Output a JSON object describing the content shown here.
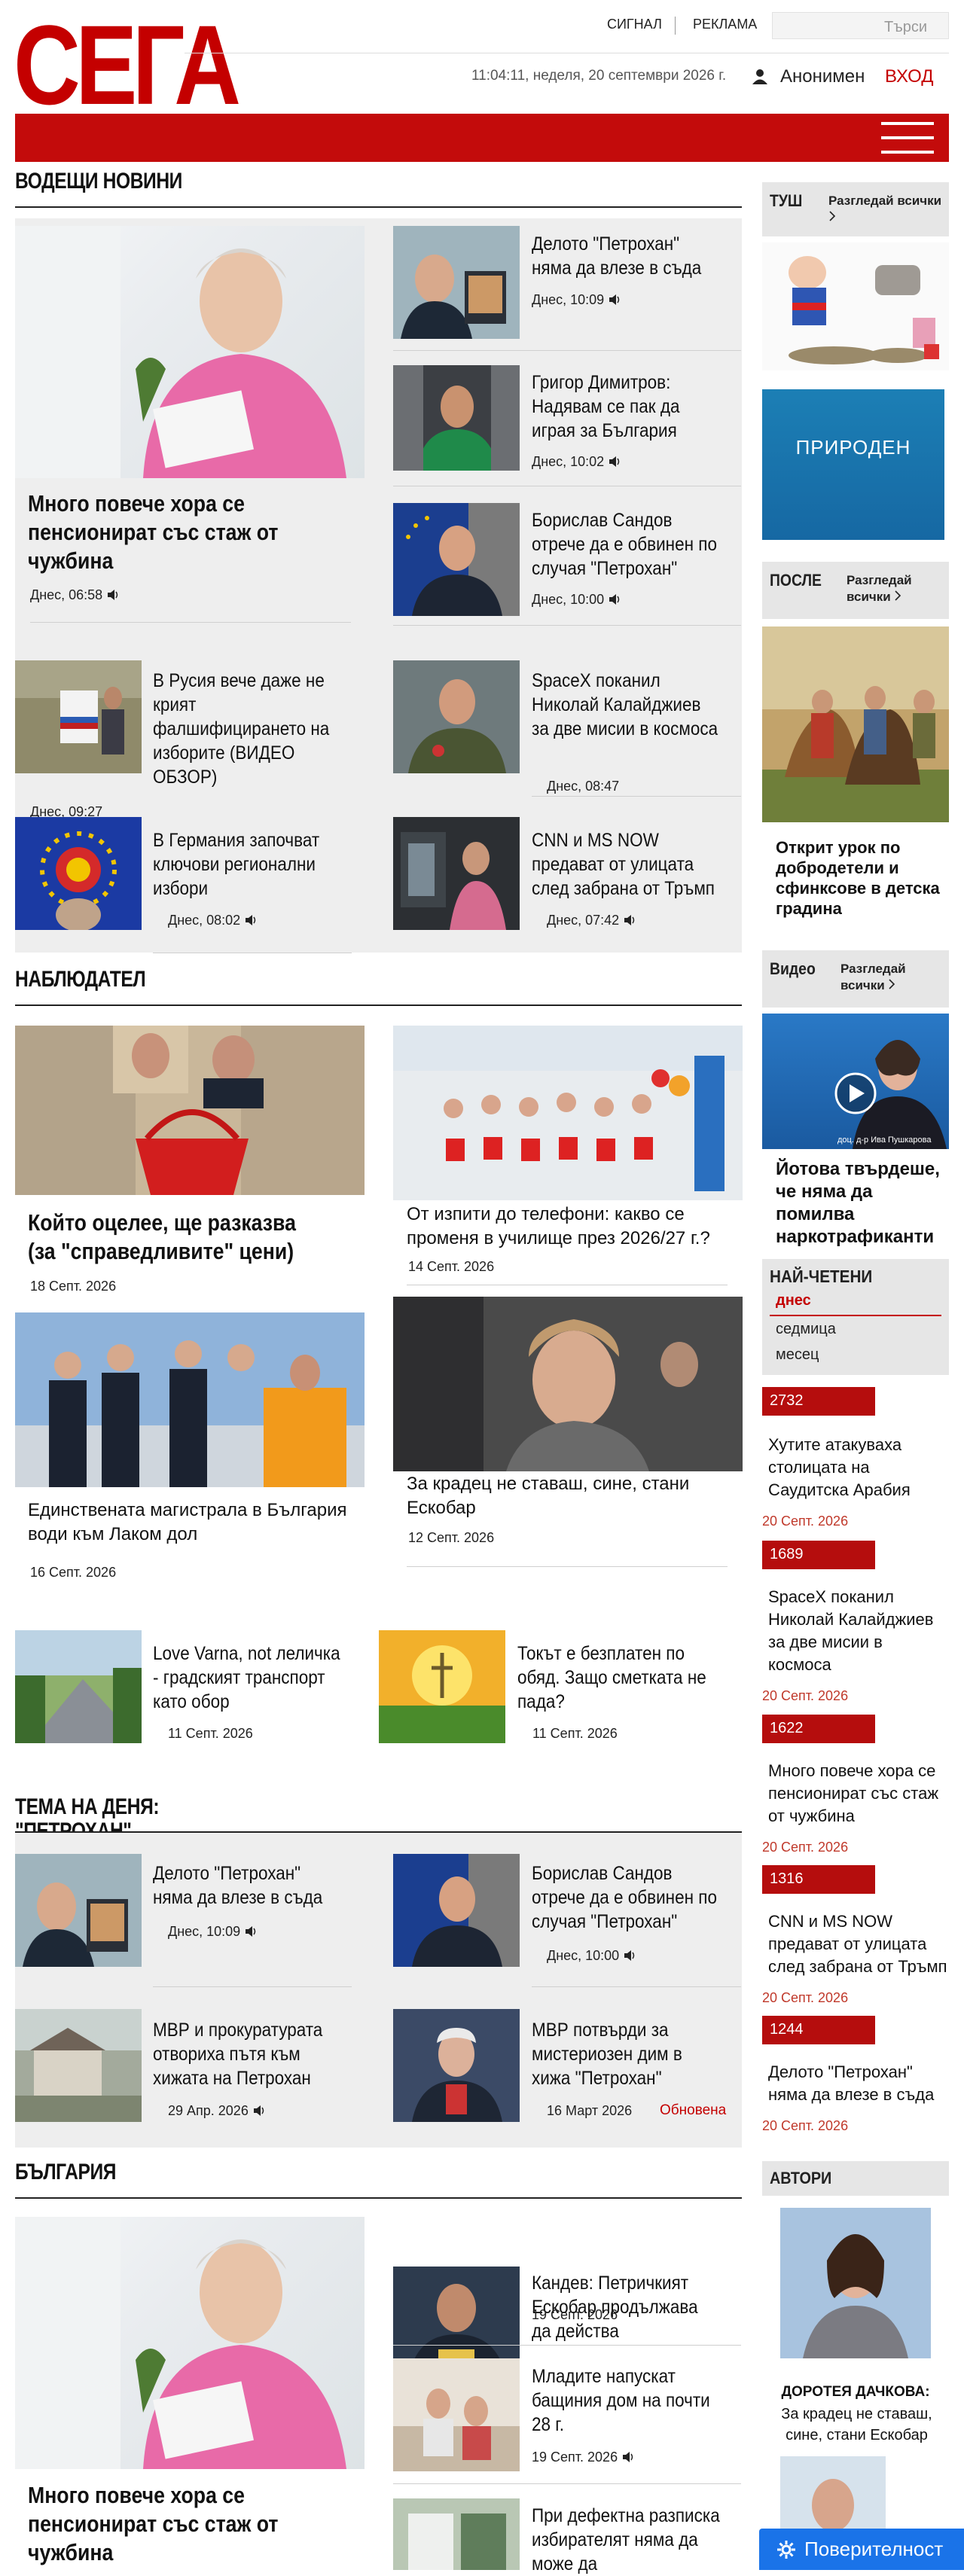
{
  "header": {
    "logo": "СЕГА",
    "nav_signal": "СИГНАЛ",
    "nav_ads": "РЕКЛАМА",
    "search_placeholder": "Търси",
    "datetime": "11:04:11, неделя, 20 септември 2026 г.",
    "user": "Анонимен",
    "login": "ВХОД"
  },
  "leading": {
    "title": "ВОДЕЩИ НОВИНИ",
    "main": {
      "title": "Много повече хора се пенсионират със стаж от чужбина",
      "time": "Днес, 06:58"
    },
    "right": [
      {
        "title": "Делото \"Петрохан\" няма да влезе в съда",
        "time": "Днес, 10:09"
      },
      {
        "title": "Григор Димитров: Надявам се пак да играя за България",
        "time": "Днес, 10:02"
      },
      {
        "title": "Борислав Сандов отрече да е обвинен по случая \"Петрохан\"",
        "time": "Днес, 10:00"
      }
    ],
    "grid": [
      {
        "title": "В Русия вече даже не крият фалшифицирането на изборите (ВИДЕО ОБЗОР)",
        "time": "Днес, 09:27"
      },
      {
        "title": "SpaceX поканил Николай Калайджиев за две мисии в космоса",
        "time": "Днес, 08:47"
      },
      {
        "title": "В Германия започват ключови регионални избори",
        "time": "Днес, 08:02"
      },
      {
        "title": "CNN и MS NOW предават от улицата след забрана от Тръмп",
        "time": "Днес, 07:42"
      }
    ]
  },
  "observer": {
    "title": "НАБЛЮДАТЕЛ",
    "items": [
      {
        "title": "Който оцелее, ще разказва (за \"справедливите\" цени)",
        "time": "18 Септ. 2026"
      },
      {
        "title": "От изпити до телефони: какво се променя в училище през 2026/27 г.?",
        "time": "14 Септ. 2026"
      },
      {
        "title": "Единствената магистрала в България води към Лаком дол",
        "time": "16 Септ. 2026"
      },
      {
        "title": "За крадец не ставаш, сине, стани Ескобар",
        "time": "12 Септ. 2026"
      },
      {
        "title": "Love Varna, not леличка - градският транспорт като обор",
        "time": "11 Септ. 2026"
      },
      {
        "title": "Токът е безплатен по обяд. Защо сметката не пада?",
        "time": "11 Септ. 2026"
      }
    ]
  },
  "topic": {
    "title": "ТЕМА НА ДЕНЯ: \"ПЕТРОХАН\"",
    "items": [
      {
        "title": "Делото \"Петрохан\" няма да влезе в съда",
        "time": "Днес, 10:09"
      },
      {
        "title": "Борислав Сандов отрече да е обвинен по случая \"Петрохан\"",
        "time": "Днес, 10:00"
      },
      {
        "title": "МВР и прокуратурата отвориха пътя към хижата на Петрохан",
        "time": "29 Апр. 2026"
      },
      {
        "title": "МВР потвърди за мистериозен дим в хижа \"Петрохан\"",
        "time": "16 Март 2026",
        "updated": "Обновена"
      }
    ]
  },
  "bulgaria": {
    "title": "БЪЛГАРИЯ",
    "main": {
      "title": "Много повече хора се пенсионират със стаж от чужбина"
    },
    "right": [
      {
        "title": "Кандев: Петричкият Ескобар продължава да действа",
        "time": "19 Септ. 2026"
      },
      {
        "title": "Младите напускат бащиния дом на почти 28 г.",
        "time": "19 Септ. 2026"
      },
      {
        "title": "При дефектна разписка избирателят няма да може да",
        "time": ""
      }
    ]
  },
  "sidebar": {
    "tush": {
      "label": "ТУШ",
      "more": "Разгледай всички"
    },
    "ad": {
      "text": "ПРИРОДЕН"
    },
    "posle": {
      "label": "ПОСЛЕ",
      "more": "Разгледай всички",
      "article": "Открит урок по добродетели и сфинксове в детска градина"
    },
    "video": {
      "label": "Видео",
      "more": "Разгледай всички",
      "article": "Йотова твърдеше, че няма да помилва наркотрафиканти",
      "caption": "доц. д-р Ива Пушкарова"
    },
    "mostread": {
      "label": "НАЙ-ЧЕТЕНИ",
      "tabs": [
        "днес",
        "седмица",
        "месец"
      ],
      "items": [
        {
          "count": "2732",
          "title": "Хутите атакуваха столицата на Саудитска Арабия",
          "date": "20 Септ. 2026"
        },
        {
          "count": "1689",
          "title": "SpaceX поканил Николай Калайджиев за две мисии в космоса",
          "date": "20 Септ. 2026"
        },
        {
          "count": "1622",
          "title": "Много повече хора се пенсионират със стаж от чужбина",
          "date": "20 Септ. 2026"
        },
        {
          "count": "1316",
          "title": "CNN и MS NOW предават от улицата след забрана от Тръмп",
          "date": "20 Септ. 2026"
        },
        {
          "count": "1244",
          "title": "Делото \"Петрохан\" няма да влезе в съда",
          "date": "20 Септ. 2026"
        }
      ]
    },
    "authors": {
      "label": "АВТОРИ",
      "name": "ДОРОТЕЯ ДАЧКОВА:",
      "article": "За крадец не ставаш, сине, стани Ескобар"
    }
  },
  "privacy": {
    "label": "Поверителност"
  },
  "colors": {
    "brand_red": "#c30b0b",
    "panel_gray": "#eeeeee",
    "privacy_blue": "#1a73e8"
  }
}
